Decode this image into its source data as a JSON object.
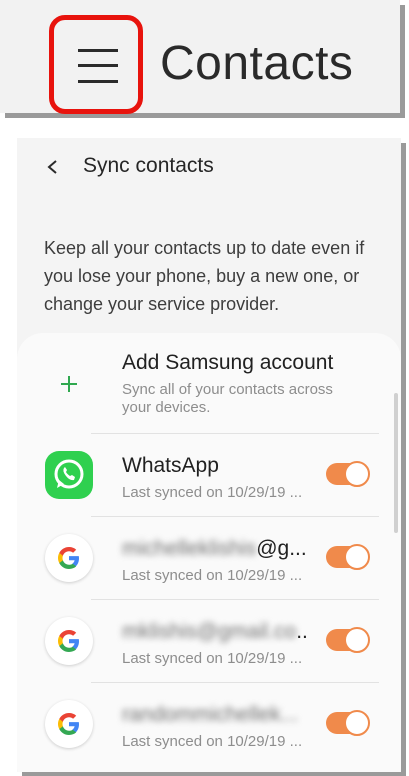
{
  "header": {
    "title": "Contacts",
    "menu_icon": "hamburger-menu-icon",
    "highlight_color": "#e8130d"
  },
  "sync": {
    "back_icon": "chevron-left-icon",
    "title": "Sync contacts",
    "description": "Keep all your contacts up to date even if you lose your phone, buy a new one, or change your service provider."
  },
  "add_account": {
    "title": "Add Samsung account",
    "subtitle_line1": "Sync all of your contacts across",
    "subtitle_line2": "your devices.",
    "icon": "plus-icon"
  },
  "accounts": [
    {
      "name": "WhatsApp",
      "subtitle": "Last synced on 10/29/19 ...",
      "icon": "whatsapp-icon",
      "enabled": true
    },
    {
      "name_blurred": "michelleklishis",
      "name_visible": "@g...",
      "subtitle": "Last synced on 10/29/19 ...",
      "icon": "google-icon",
      "enabled": true
    },
    {
      "name_blurred": "mklishis@gmail.co",
      "name_visible": "..",
      "subtitle": "Last synced on 10/29/19 ...",
      "icon": "google-icon",
      "enabled": true
    },
    {
      "name_blurred": "randommichellek...",
      "name_visible": "",
      "subtitle": "Last synced on 10/29/19 ...",
      "icon": "google-icon",
      "enabled": true
    }
  ],
  "colors": {
    "toggle_on": "#f08a4b",
    "whatsapp_green": "#2fd04f",
    "plus_green": "#2fa84f"
  }
}
